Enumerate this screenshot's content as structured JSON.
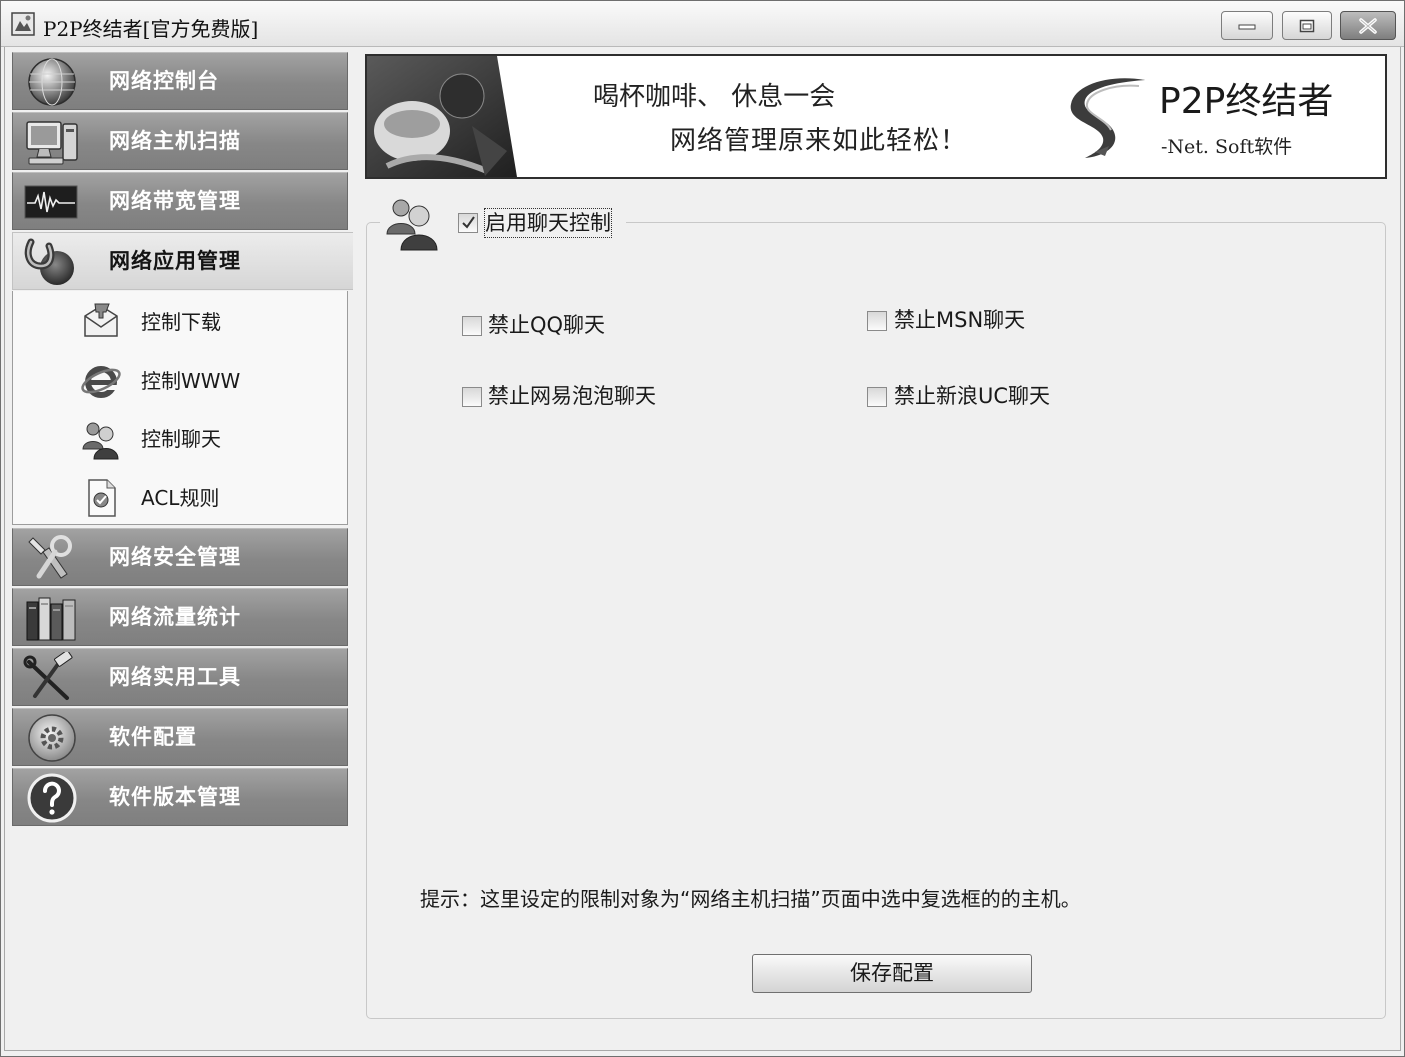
{
  "window": {
    "title": "P2P终结者[官方免费版]",
    "app_icon": "app-logo-icon",
    "controls": {
      "minimize": "minimize-icon",
      "maximize": "maximize-icon",
      "close": "close-icon"
    }
  },
  "sidebar": {
    "items": [
      {
        "label": "网络控制台",
        "icon": "globe-icon"
      },
      {
        "label": "网络主机扫描",
        "icon": "computer-icon"
      },
      {
        "label": "网络带宽管理",
        "icon": "bandwidth-wave-icon"
      },
      {
        "label": "网络应用管理",
        "icon": "application-icon",
        "selected": true
      },
      {
        "label": "网络安全管理",
        "icon": "security-tools-icon"
      },
      {
        "label": "网络流量统计",
        "icon": "traffic-books-icon"
      },
      {
        "label": "网络实用工具",
        "icon": "hammer-wrench-icon"
      },
      {
        "label": "软件配置",
        "icon": "settings-gear-icon"
      },
      {
        "label": "软件版本管理",
        "icon": "help-question-icon"
      }
    ],
    "subitems": [
      {
        "label": "控制下载",
        "icon": "download-envelope-icon"
      },
      {
        "label": "控制WWW",
        "icon": "internet-explorer-icon"
      },
      {
        "label": "控制聊天",
        "icon": "chat-users-icon",
        "selected": true
      },
      {
        "label": "ACL规则",
        "icon": "acl-document-icon"
      }
    ]
  },
  "banner": {
    "line1": "喝杯咖啡、 休息一会",
    "line2": "网络管理原来如此轻松！",
    "brand": "P2P终结者",
    "brand_sub": "-Net. Soft软件",
    "photo": "banner-photo",
    "logo": "swoosh-logo-icon"
  },
  "chat_control": {
    "group_icon": "chat-users-icon",
    "enable_label": "启用聊天控制",
    "enabled": true,
    "options": [
      {
        "label": "禁止QQ聊天",
        "checked": false
      },
      {
        "label": "禁止MSN聊天",
        "checked": false
      },
      {
        "label": "禁止网易泡泡聊天",
        "checked": false
      },
      {
        "label": "禁止新浪UC聊天",
        "checked": false
      }
    ]
  },
  "hint": {
    "text": "提示：这里设定的限制对象为“网络主机扫描”页面中选中复选框的的主机。"
  },
  "save_button": {
    "label": "保存配置"
  },
  "theme": {
    "nav_item_bg": "#878787",
    "nav_item_text": "#ffffff",
    "nav_selected_bg": "#dedede",
    "window_bg": "#f0f0f0",
    "banner_border": "#2e2e2e"
  }
}
